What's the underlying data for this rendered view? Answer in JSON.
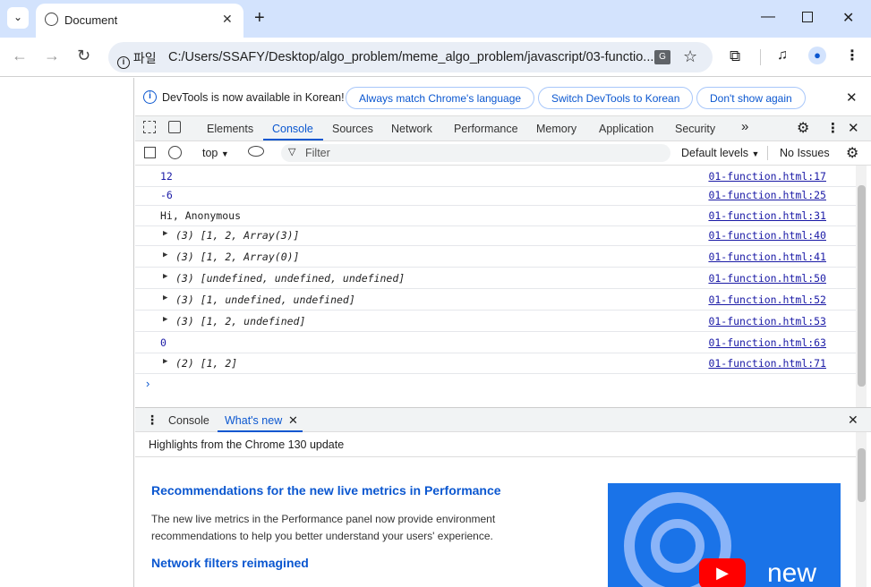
{
  "browser": {
    "tab_title": "Document",
    "new_tab": "+",
    "url_scheme": "파일",
    "url": "C:/Users/SSAFY/Desktop/algo_problem/meme_algo_problem/javascript/03-functio..."
  },
  "infobar": {
    "message": "DevTools is now available in Korean!",
    "btn_match": "Always match Chrome's language",
    "btn_switch": "Switch DevTools to Korean",
    "btn_dismiss": "Don't show again"
  },
  "devtools_tabs": [
    "Elements",
    "Console",
    "Sources",
    "Network",
    "Performance",
    "Memory",
    "Application",
    "Security"
  ],
  "filterbar": {
    "context": "top",
    "filter_placeholder": "Filter",
    "levels": "Default levels",
    "issues": "No Issues"
  },
  "console_rows": [
    {
      "text": "12",
      "src": "01-function.html:17",
      "type": "num"
    },
    {
      "text": "-6",
      "src": "01-function.html:25",
      "type": "num"
    },
    {
      "text": "Hi, Anonymous",
      "src": "01-function.html:31",
      "type": "str"
    },
    {
      "text": "(3) [1, 2, Array(3)]",
      "src": "01-function.html:40",
      "type": "obj"
    },
    {
      "text": "(3) [1, 2, Array(0)]",
      "src": "01-function.html:41",
      "type": "obj"
    },
    {
      "text": "(3) [undefined, undefined, undefined]",
      "src": "01-function.html:50",
      "type": "obj"
    },
    {
      "text": "(3) [1, undefined, undefined]",
      "src": "01-function.html:52",
      "type": "obj"
    },
    {
      "text": "(3) [1, 2, undefined]",
      "src": "01-function.html:53",
      "type": "obj"
    },
    {
      "text": "0",
      "src": "01-function.html:63",
      "type": "num"
    },
    {
      "text": "(2) [1, 2]",
      "src": "01-function.html:71",
      "type": "obj"
    }
  ],
  "drawer": {
    "tab_console": "Console",
    "tab_whatsnew": "What's new",
    "highlights": "Highlights from the Chrome 130 update",
    "heading1": "Recommendations for the new live metrics in Performance",
    "body1": "The new live metrics in the Performance panel now provide environment recommendations to help you better understand your users' experience.",
    "heading2": "Network filters reimagined",
    "thumb_text": "new"
  },
  "colors": {
    "accent": "#0b57d0",
    "titlebar": "#d3e3fd",
    "console_num": "#1a1aa6"
  }
}
